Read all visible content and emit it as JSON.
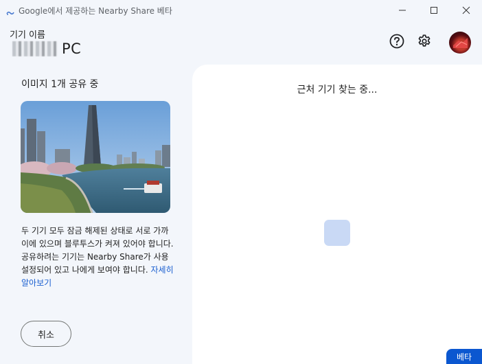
{
  "window": {
    "title": "Google에서 제공하는 Nearby Share 베타",
    "icons": {
      "app": "nearby-share-icon",
      "minimize": "minimize-icon",
      "maximize": "maximize-icon",
      "close": "close-icon"
    }
  },
  "header": {
    "device_label": "기기 이름",
    "device_name_suffix": "PC",
    "icons": {
      "help": "help-icon",
      "settings": "gear-icon",
      "avatar": "avatar"
    }
  },
  "left": {
    "share_title": "이미지 1개 공유 중",
    "info_text": "두 기기 모두 잠금 해제된 상태로 서로 가까이에 있으며 블루투스가 켜져 있어야 합니다. 공유하려는 기기는 Nearby Share가 사용 설정되어 있고 나에게 보여야 합니다.",
    "learn_more": "자세히 알아보기",
    "cancel_label": "취소"
  },
  "right": {
    "searching_text": "근처 기기 찾는 중..."
  },
  "badge": {
    "beta_label": "베타"
  },
  "colors": {
    "accent": "#0b57d0",
    "link": "#1a5fd0",
    "loader": "#c9d9f5",
    "background": "#f3f6fb"
  }
}
